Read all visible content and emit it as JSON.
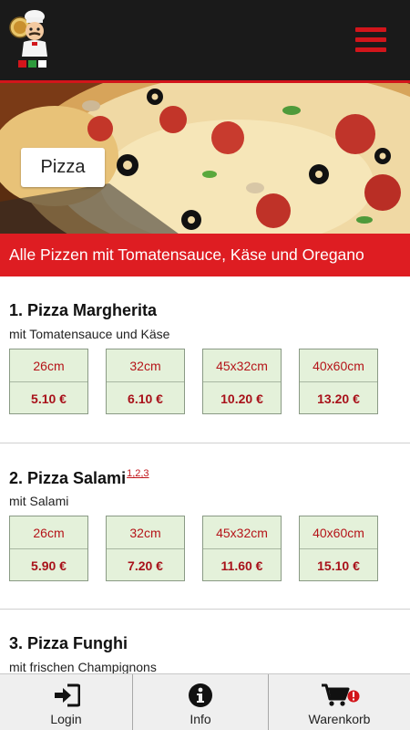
{
  "header": {
    "logo_icon": "pizza-chef-logo-icon",
    "menu_icon": "hamburger-menu-icon"
  },
  "hero": {
    "category_label": "Pizza"
  },
  "banner": {
    "text": "Alle Pizzen mit Tomatensauce, Käse und Oregano"
  },
  "products": [
    {
      "name": "1. Pizza Margherita",
      "superscript": "",
      "description": "mit Tomatensauce und Käse",
      "sizes": [
        {
          "label": "26cm",
          "price": "5.10 €"
        },
        {
          "label": "32cm",
          "price": "6.10 €"
        },
        {
          "label": "45x32cm",
          "price": "10.20 €"
        },
        {
          "label": "40x60cm",
          "price": "13.20 €"
        }
      ]
    },
    {
      "name": "2. Pizza Salami",
      "superscript": "1,2,3",
      "description": "mit Salami",
      "sizes": [
        {
          "label": "26cm",
          "price": "5.90 €"
        },
        {
          "label": "32cm",
          "price": "7.20 €"
        },
        {
          "label": "45x32cm",
          "price": "11.60 €"
        },
        {
          "label": "40x60cm",
          "price": "15.10 €"
        }
      ]
    },
    {
      "name": "3. Pizza Funghi",
      "superscript": "",
      "description": "mit frischen Champignons",
      "sizes": []
    }
  ],
  "bottom_nav": [
    {
      "label": "Login",
      "icon": "login-icon"
    },
    {
      "label": "Info",
      "icon": "info-icon"
    },
    {
      "label": "Warenkorb",
      "icon": "cart-icon"
    }
  ],
  "colors": {
    "accent": "#de1d22",
    "header": "#1a1a1a",
    "size_box": "#e4f1da",
    "price": "#a8111a"
  }
}
